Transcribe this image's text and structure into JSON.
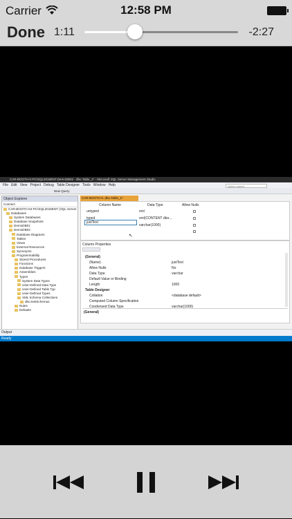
{
  "status_bar": {
    "carrier": "Carrier",
    "time": "12:58 PM"
  },
  "player": {
    "done_label": "Done",
    "elapsed": "1:11",
    "remaining": "-2:27",
    "progress_fraction": 0.33
  },
  "video": {
    "window_title": "CAR-BOOTH-0-PC\\SQL2016ENT.DemoDB02 - dbo.Table_1* - Microsoft SQL Server Management Studio",
    "menu": [
      "File",
      "Edit",
      "View",
      "Project",
      "Debug",
      "Table Designer",
      "Tools",
      "Window",
      "Help"
    ],
    "quick_launch": "Quick Launch",
    "toolbar_new_query": "New Query",
    "object_explorer": {
      "title": "Object Explorer",
      "connect": "Connect",
      "items": [
        "CAR-BOOTH-04-PC\\SQL2016ENT (SQL Server",
        "Databases",
        "System Databases",
        "Database Snapshots",
        "DemoDB01",
        "DemoDB02",
        "Database Diagrams",
        "Tables",
        "Views",
        "External Resources",
        "Synonyms",
        "Programmability",
        "Stored Procedures",
        "Functions",
        "Database Triggers",
        "Assemblies",
        "Types",
        "System Data Types",
        "User-Defined Data Type",
        "User-Defined Table Typ",
        "User-Defined Types",
        "XML Schema Collections",
        "dbo.testSchema1",
        "Rules",
        "Defaults"
      ]
    },
    "tab_title": "CAR-BOOTH-0..dbo.Table_1*",
    "grid": {
      "headers": [
        "Column Name",
        "Data Type",
        "Allow Nulls"
      ],
      "rows": [
        {
          "name": "untyped",
          "type": "xml"
        },
        {
          "name": "typed",
          "type": "xml(CONTENT dbo..."
        },
        {
          "name": "justText",
          "type": "varchar(1000)"
        }
      ]
    },
    "properties": {
      "tab": "Column Properties",
      "rows": [
        {
          "label": "(General)",
          "value": ""
        },
        {
          "label": "(Name)",
          "value": "justText"
        },
        {
          "label": "Allow Nulls",
          "value": "No"
        },
        {
          "label": "Data Type",
          "value": "varchar"
        },
        {
          "label": "Default Value or Binding",
          "value": ""
        },
        {
          "label": "Length",
          "value": "1000"
        },
        {
          "label": "Table Designer",
          "value": ""
        },
        {
          "label": "Collation",
          "value": "<database default>"
        },
        {
          "label": "Computed Column Specification",
          "value": ""
        },
        {
          "label": "Condensed Data Type",
          "value": "varchar(1000)"
        }
      ],
      "description": "(General)"
    },
    "output_label": "Output",
    "status": "Ready"
  },
  "colors": {
    "chrome": "#d8d8d8",
    "accent_tab": "#e8a33b",
    "status_blue": "#007acc"
  },
  "icons": {
    "prev": "skip-back-icon",
    "pause": "pause-icon",
    "next": "skip-forward-icon"
  }
}
